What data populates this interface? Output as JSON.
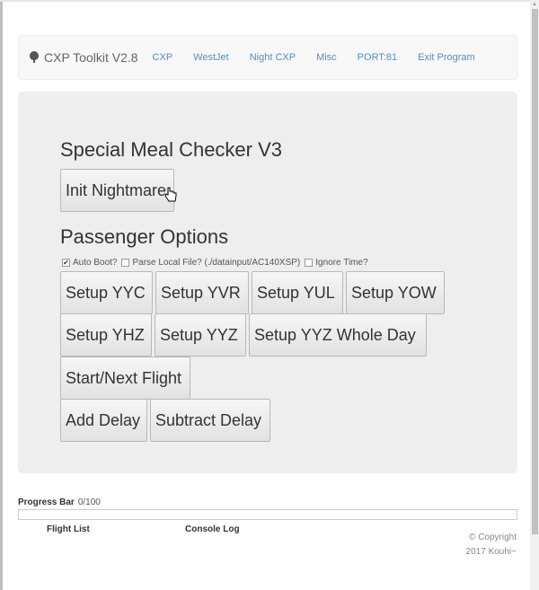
{
  "navbar": {
    "brand_icon": "tree-icon",
    "brand": "CXP Toolkit V2.8",
    "links": [
      {
        "label": "CXP"
      },
      {
        "label": "WestJet"
      },
      {
        "label": "Night CXP"
      },
      {
        "label": "Misc"
      },
      {
        "label": "PORT:81"
      },
      {
        "label": "Exit Program"
      }
    ],
    "link_color": "#4d8fcf"
  },
  "main": {
    "title": "Special Meal Checker V3",
    "init_button": "Init Nightmare",
    "passenger_heading": "Passenger Options",
    "options": [
      {
        "label": "Auto Boot?",
        "checked": true
      },
      {
        "label": "Parse Local File? (./datainput/AC140XSP)",
        "checked": false
      },
      {
        "label": "Ignore Time?",
        "checked": false
      }
    ],
    "buttons": {
      "setup_yyc": "Setup YYC",
      "setup_yvr": "Setup YVR",
      "setup_yul": "Setup YUL",
      "setup_yow": "Setup YOW",
      "setup_yhz": "Setup YHZ",
      "setup_yyz": "Setup YYZ",
      "setup_yyz_whole_day": "Setup YYZ Whole Day",
      "start_next_flight": "Start/Next Flight",
      "add_delay": "Add Delay",
      "subtract_delay": "Subtract Delay"
    }
  },
  "progress": {
    "label": "Progress Bar",
    "value_text": "0/100",
    "value": 0,
    "max": 100
  },
  "footer": {
    "flight_list": "Flight List",
    "console_log": "Console Log",
    "copyright_line1": "© Copyright",
    "copyright_line2": "2017 Kouhi~"
  }
}
